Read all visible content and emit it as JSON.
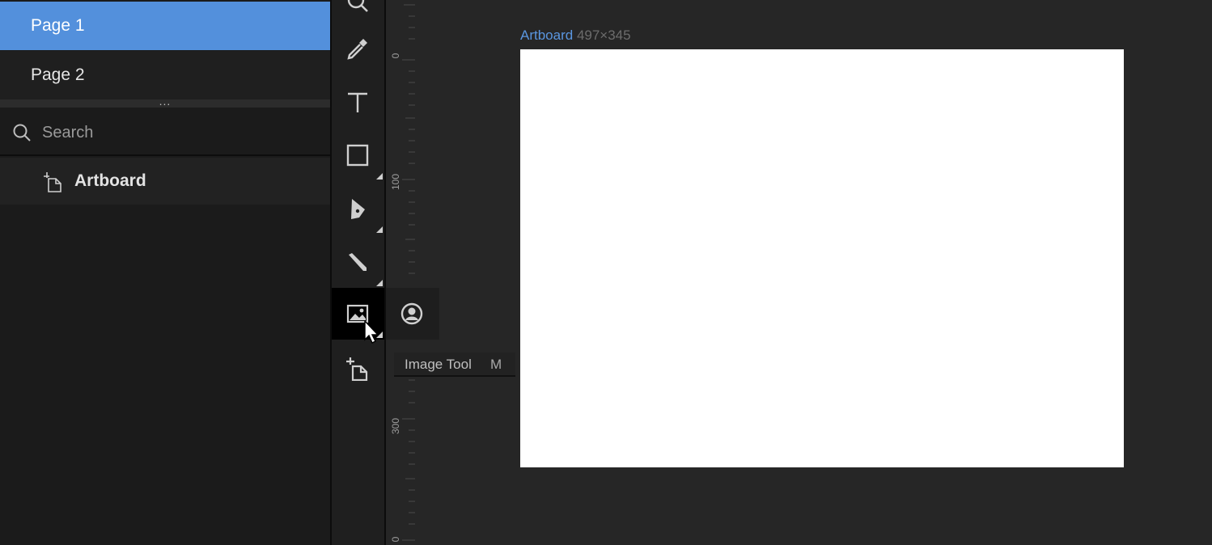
{
  "pages": [
    {
      "label": "Page 1",
      "selected": true
    },
    {
      "label": "Page 2",
      "selected": false
    }
  ],
  "splitter": {
    "dots": "..."
  },
  "search": {
    "placeholder": "Search",
    "icon": "search-icon"
  },
  "layers": [
    {
      "label": "Artboard",
      "icon": "artboard-icon"
    }
  ],
  "toolbar": {
    "tools": [
      {
        "name": "zoom-tool",
        "icon": "magnifier-icon"
      },
      {
        "name": "eyedropper-tool",
        "icon": "eyedropper-icon"
      },
      {
        "name": "text-tool",
        "icon": "text-icon"
      },
      {
        "name": "rectangle-tool",
        "icon": "rectangle-icon"
      },
      {
        "name": "pen-tool",
        "icon": "pen-icon"
      },
      {
        "name": "pencil-tool",
        "icon": "pencil-icon"
      },
      {
        "name": "image-tool",
        "icon": "image-icon",
        "active": true
      },
      {
        "name": "artboard-tool",
        "icon": "artboard-icon"
      }
    ]
  },
  "ruler": {
    "labels": [
      "0",
      "100",
      "300",
      "0"
    ]
  },
  "flyout": {
    "icon": "avatar-image-icon"
  },
  "tooltip": {
    "name": "Image Tool",
    "shortcut": "M"
  },
  "artboard": {
    "name": "Artboard",
    "dimensions": "497×345"
  },
  "colors": {
    "accent": "#5390dc",
    "panel": "#1b1b1b",
    "canvas": "#262626",
    "artboard": "#ffffff"
  }
}
